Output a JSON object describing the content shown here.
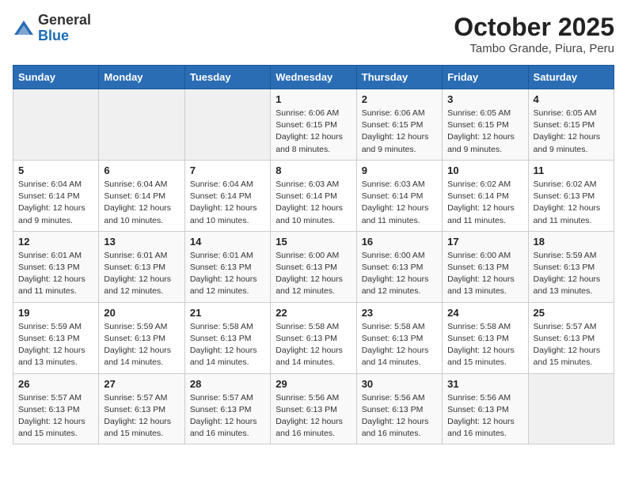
{
  "header": {
    "logo": {
      "general": "General",
      "blue": "Blue"
    },
    "title": "October 2025",
    "location": "Tambo Grande, Piura, Peru"
  },
  "days_of_week": [
    "Sunday",
    "Monday",
    "Tuesday",
    "Wednesday",
    "Thursday",
    "Friday",
    "Saturday"
  ],
  "weeks": [
    [
      {
        "day": "",
        "info": ""
      },
      {
        "day": "",
        "info": ""
      },
      {
        "day": "",
        "info": ""
      },
      {
        "day": "1",
        "info": "Sunrise: 6:06 AM\nSunset: 6:15 PM\nDaylight: 12 hours\nand 8 minutes."
      },
      {
        "day": "2",
        "info": "Sunrise: 6:06 AM\nSunset: 6:15 PM\nDaylight: 12 hours\nand 9 minutes."
      },
      {
        "day": "3",
        "info": "Sunrise: 6:05 AM\nSunset: 6:15 PM\nDaylight: 12 hours\nand 9 minutes."
      },
      {
        "day": "4",
        "info": "Sunrise: 6:05 AM\nSunset: 6:15 PM\nDaylight: 12 hours\nand 9 minutes."
      }
    ],
    [
      {
        "day": "5",
        "info": "Sunrise: 6:04 AM\nSunset: 6:14 PM\nDaylight: 12 hours\nand 9 minutes."
      },
      {
        "day": "6",
        "info": "Sunrise: 6:04 AM\nSunset: 6:14 PM\nDaylight: 12 hours\nand 10 minutes."
      },
      {
        "day": "7",
        "info": "Sunrise: 6:04 AM\nSunset: 6:14 PM\nDaylight: 12 hours\nand 10 minutes."
      },
      {
        "day": "8",
        "info": "Sunrise: 6:03 AM\nSunset: 6:14 PM\nDaylight: 12 hours\nand 10 minutes."
      },
      {
        "day": "9",
        "info": "Sunrise: 6:03 AM\nSunset: 6:14 PM\nDaylight: 12 hours\nand 11 minutes."
      },
      {
        "day": "10",
        "info": "Sunrise: 6:02 AM\nSunset: 6:14 PM\nDaylight: 12 hours\nand 11 minutes."
      },
      {
        "day": "11",
        "info": "Sunrise: 6:02 AM\nSunset: 6:13 PM\nDaylight: 12 hours\nand 11 minutes."
      }
    ],
    [
      {
        "day": "12",
        "info": "Sunrise: 6:01 AM\nSunset: 6:13 PM\nDaylight: 12 hours\nand 11 minutes."
      },
      {
        "day": "13",
        "info": "Sunrise: 6:01 AM\nSunset: 6:13 PM\nDaylight: 12 hours\nand 12 minutes."
      },
      {
        "day": "14",
        "info": "Sunrise: 6:01 AM\nSunset: 6:13 PM\nDaylight: 12 hours\nand 12 minutes."
      },
      {
        "day": "15",
        "info": "Sunrise: 6:00 AM\nSunset: 6:13 PM\nDaylight: 12 hours\nand 12 minutes."
      },
      {
        "day": "16",
        "info": "Sunrise: 6:00 AM\nSunset: 6:13 PM\nDaylight: 12 hours\nand 12 minutes."
      },
      {
        "day": "17",
        "info": "Sunrise: 6:00 AM\nSunset: 6:13 PM\nDaylight: 12 hours\nand 13 minutes."
      },
      {
        "day": "18",
        "info": "Sunrise: 5:59 AM\nSunset: 6:13 PM\nDaylight: 12 hours\nand 13 minutes."
      }
    ],
    [
      {
        "day": "19",
        "info": "Sunrise: 5:59 AM\nSunset: 6:13 PM\nDaylight: 12 hours\nand 13 minutes."
      },
      {
        "day": "20",
        "info": "Sunrise: 5:59 AM\nSunset: 6:13 PM\nDaylight: 12 hours\nand 14 minutes."
      },
      {
        "day": "21",
        "info": "Sunrise: 5:58 AM\nSunset: 6:13 PM\nDaylight: 12 hours\nand 14 minutes."
      },
      {
        "day": "22",
        "info": "Sunrise: 5:58 AM\nSunset: 6:13 PM\nDaylight: 12 hours\nand 14 minutes."
      },
      {
        "day": "23",
        "info": "Sunrise: 5:58 AM\nSunset: 6:13 PM\nDaylight: 12 hours\nand 14 minutes."
      },
      {
        "day": "24",
        "info": "Sunrise: 5:58 AM\nSunset: 6:13 PM\nDaylight: 12 hours\nand 15 minutes."
      },
      {
        "day": "25",
        "info": "Sunrise: 5:57 AM\nSunset: 6:13 PM\nDaylight: 12 hours\nand 15 minutes."
      }
    ],
    [
      {
        "day": "26",
        "info": "Sunrise: 5:57 AM\nSunset: 6:13 PM\nDaylight: 12 hours\nand 15 minutes."
      },
      {
        "day": "27",
        "info": "Sunrise: 5:57 AM\nSunset: 6:13 PM\nDaylight: 12 hours\nand 15 minutes."
      },
      {
        "day": "28",
        "info": "Sunrise: 5:57 AM\nSunset: 6:13 PM\nDaylight: 12 hours\nand 16 minutes."
      },
      {
        "day": "29",
        "info": "Sunrise: 5:56 AM\nSunset: 6:13 PM\nDaylight: 12 hours\nand 16 minutes."
      },
      {
        "day": "30",
        "info": "Sunrise: 5:56 AM\nSunset: 6:13 PM\nDaylight: 12 hours\nand 16 minutes."
      },
      {
        "day": "31",
        "info": "Sunrise: 5:56 AM\nSunset: 6:13 PM\nDaylight: 12 hours\nand 16 minutes."
      },
      {
        "day": "",
        "info": ""
      }
    ]
  ]
}
